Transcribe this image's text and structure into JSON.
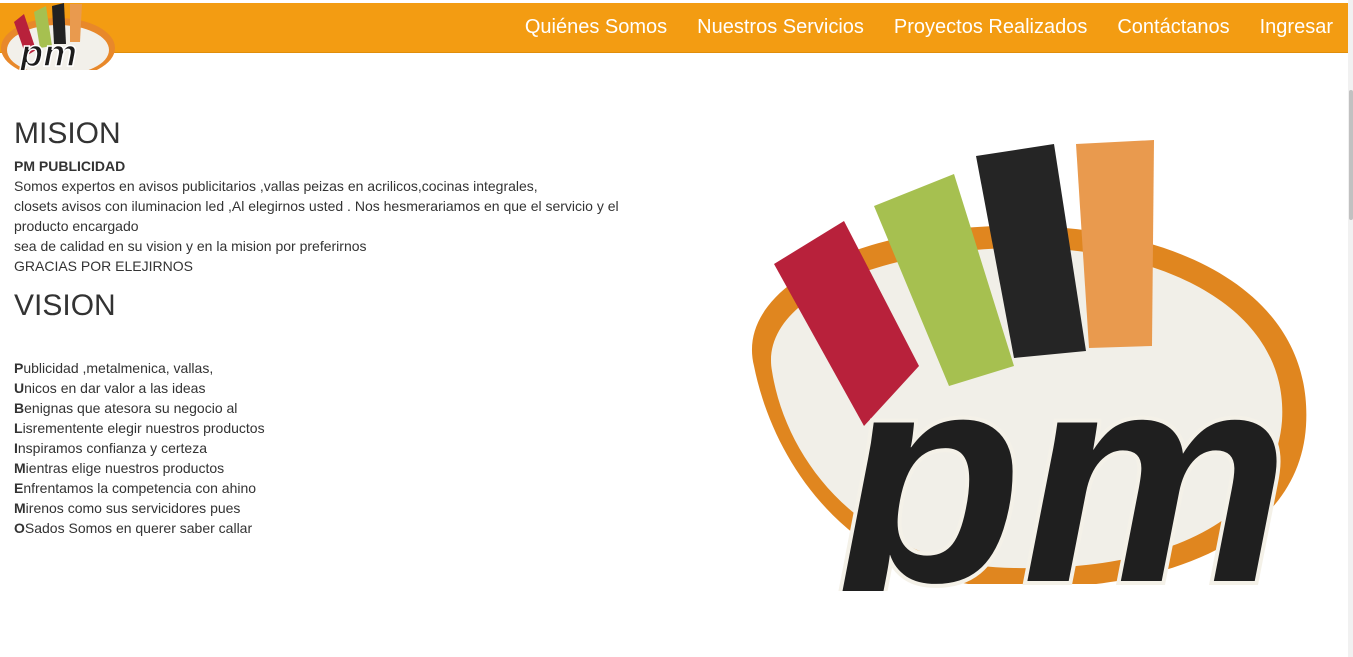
{
  "brand": {
    "logo_text": "pm"
  },
  "nav": {
    "items": [
      {
        "label": "Quiénes Somos"
      },
      {
        "label": "Nuestros Servicios"
      },
      {
        "label": "Proyectos Realizados"
      },
      {
        "label": "Contáctanos"
      },
      {
        "label": "Ingresar"
      }
    ]
  },
  "colors": {
    "navbar": "#f39c12",
    "logo_red": "#b8213b",
    "logo_green": "#a6c050",
    "logo_black": "#222222",
    "logo_orange": "#e99a4e"
  },
  "mision": {
    "title": "MISION",
    "company": "PM PUBLICIDAD",
    "lines": [
      "Somos expertos en avisos publicitarios ,vallas peizas en acrilicos,cocinas integrales,",
      "closets avisos con iluminacion led ,Al elegirnos usted . Nos hesmerariamos en que el servicio y el producto encargado",
      "sea de calidad en su vision y en la mision por preferirnos",
      "GRACIAS POR ELEJIRNOS"
    ]
  },
  "vision": {
    "title": "VISION",
    "items": [
      {
        "initial": "P",
        "rest": "ublicidad ,metalmenica, vallas,"
      },
      {
        "initial": "U",
        "rest": "nicos en dar valor a las ideas"
      },
      {
        "initial": "B",
        "rest": "enignas que atesora su negocio al"
      },
      {
        "initial": "L",
        "rest": "isrementente elegir nuestros productos"
      },
      {
        "initial": "I",
        "rest": "nspiramos confianza y certeza"
      },
      {
        "initial": "M",
        "rest": "ientras elige nuestros productos"
      },
      {
        "initial": "E",
        "rest": "nfrentamos la competencia con ahino"
      },
      {
        "initial": "M",
        "rest": "irenos como sus servicidores pues"
      },
      {
        "initial": "O",
        "rest": "Sados Somos en querer saber callar"
      }
    ]
  }
}
